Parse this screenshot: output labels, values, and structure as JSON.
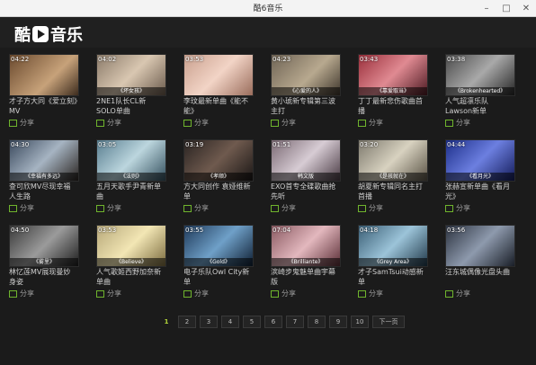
{
  "window": {
    "title": "酷6音乐",
    "minimize": "–",
    "maximize": "□",
    "close": "✕"
  },
  "logo": {
    "part1": "酷",
    "part2": "音乐"
  },
  "share_label": "分享",
  "videos": [
    {
      "duration": "04:22",
      "caption": "",
      "title": "才子方大同《爱立刻》MV",
      "bg": "linear-gradient(135deg,#6b4a2e,#c7a27a 60%,#3d2c1e)"
    },
    {
      "duration": "04:02",
      "caption": "《坏女孩》",
      "title": "2NE1队长CL新SOLO单曲",
      "bg": "linear-gradient(135deg,#8b7b6a,#d9c7b1 50%,#6a5a4c)"
    },
    {
      "duration": "03:53",
      "caption": "",
      "title": "李玟最新单曲《能不能》",
      "bg": "linear-gradient(135deg,#c9a08e,#f2d4c6 50%,#9a6d5c)"
    },
    {
      "duration": "04:23",
      "caption": "《心爱的人》",
      "title": "黄小琥新专辑第三波主打",
      "bg": "linear-gradient(135deg,#6f6455,#b8a98f 55%,#3e362c)"
    },
    {
      "duration": "03:43",
      "caption": "《靠爱取当》",
      "title": "丁丁最新悲伤歌曲首播",
      "bg": "linear-gradient(135deg,#9a2f3b,#e08a92 50%,#4c1a22)"
    },
    {
      "duration": "03:38",
      "caption": "《Brokenhearted》",
      "title": "人气超凛乐队Lawson新单",
      "bg": "linear-gradient(135deg,#4b4b4b,#a9a9a9 50%,#262626)"
    },
    {
      "duration": "04:30",
      "caption": "《幸福有多远》",
      "title": "查可欣MV尽现幸福人生路",
      "bg": "linear-gradient(135deg,#3b4a5e,#a6b4c2 50%,#2a2420)"
    },
    {
      "duration": "03:05",
      "caption": "《法则》",
      "title": "五月天歌手尹青新单曲",
      "bg": "linear-gradient(135deg,#5a7f91,#bcd6de 50%,#34505e)"
    },
    {
      "duration": "03:19",
      "caption": "《孝顺》",
      "title": "方大同创作 袁娅维新单",
      "bg": "linear-gradient(135deg,#2a2422,#6f5a4e 50%,#1b1716)"
    },
    {
      "duration": "01:51",
      "caption": "韩文版",
      "title": "EXO首专全碟歌曲抢先听",
      "bg": "linear-gradient(135deg,#7b6a74,#d7ccd4 50%,#4a3b44)"
    },
    {
      "duration": "03:20",
      "caption": "《是孩就在》",
      "title": "胡夏新专辑同名主打首播",
      "bg": "linear-gradient(135deg,#7e7a6e,#d8d2c0 50%,#5a5346)"
    },
    {
      "duration": "04:44",
      "caption": "《看月光》",
      "title": "张赫宣新单曲《看月光》",
      "bg": "linear-gradient(135deg,#1d2f8a,#6c7fe0 50%,#141c5a)"
    },
    {
      "duration": "04:50",
      "caption": "《雾里》",
      "title": "林忆莲MV展现曼妙身姿",
      "bg": "linear-gradient(135deg,#3a3a3a,#9b9b9b 50%,#1e1e1e)"
    },
    {
      "duration": "03:53",
      "caption": "《Believe》",
      "title": "人气歌姬西野加奈新单曲",
      "bg": "linear-gradient(135deg,#b7a87a,#f2e6b4 50%,#7a6a3e)"
    },
    {
      "duration": "03:55",
      "caption": "《Gold》",
      "title": "电子乐队Owl City新单",
      "bg": "linear-gradient(135deg,#1f3a5a,#6fa0c8 50%,#0f1f33)"
    },
    {
      "duration": "07:04",
      "caption": "《Brilliante》",
      "title": "滨崎步鬼魅单曲宇幕版",
      "bg": "linear-gradient(135deg,#8a5a62,#e3b8be 50%,#5a2e36)"
    },
    {
      "duration": "04:18",
      "caption": "《Grey Area》",
      "title": "才子SamTsui动感新单",
      "bg": "linear-gradient(135deg,#3b5f76,#9cc4d9 50%,#21394a)"
    },
    {
      "duration": "03:56",
      "caption": "",
      "title": "汪东城偶像光盘头曲",
      "bg": "linear-gradient(135deg,#2c3340,#8e9aad 50%,#191e27)"
    }
  ],
  "pagination": {
    "pages": [
      "1",
      "2",
      "3",
      "4",
      "5",
      "6",
      "7",
      "8",
      "9",
      "10"
    ],
    "current": "1",
    "next": "下一页"
  }
}
